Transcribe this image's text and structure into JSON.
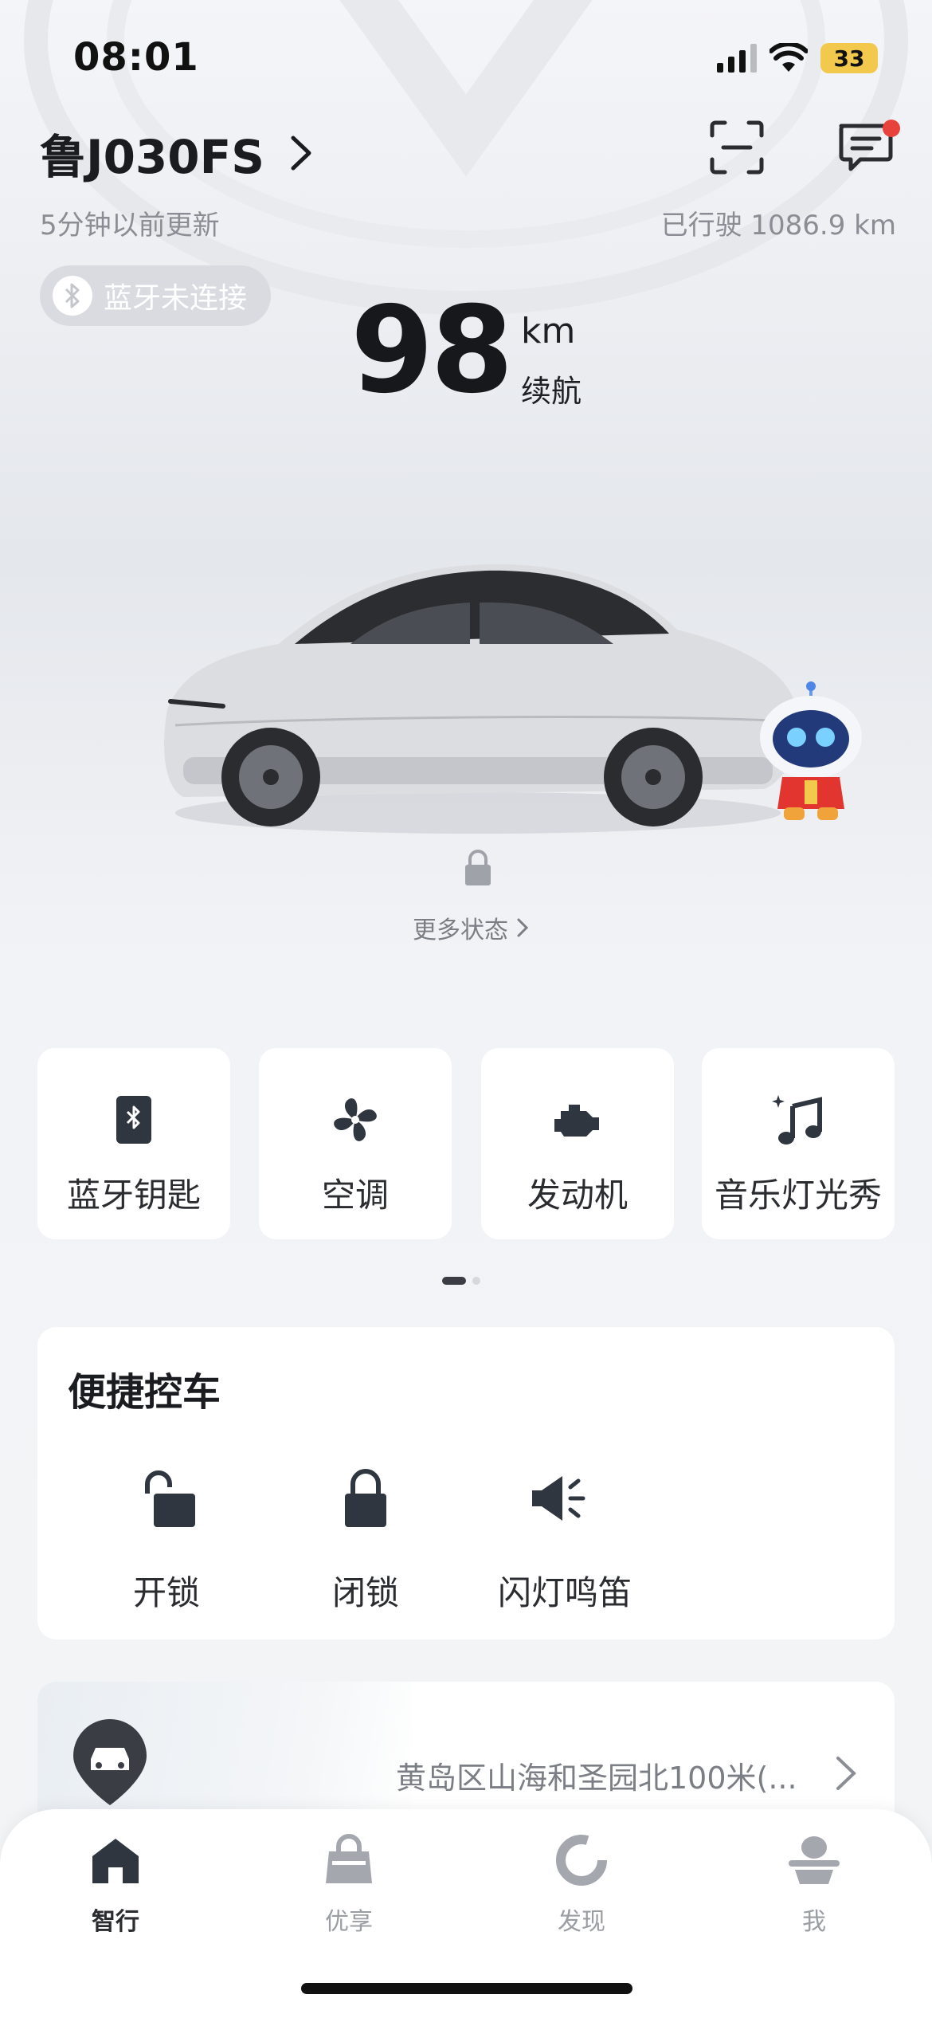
{
  "status_bar": {
    "time": "08:01",
    "battery": "33"
  },
  "header": {
    "plate": "鲁J030FS",
    "updated": "5分钟以前更新",
    "mileage": "已行驶 1086.9 km"
  },
  "bluetooth_status": "蓝牙未连接",
  "range": {
    "value": "98",
    "unit": "km",
    "label": "续航"
  },
  "more_status": "更多状态",
  "function_cards": [
    {
      "label": "蓝牙钥匙",
      "icon": "bluetooth-key-icon"
    },
    {
      "label": "空调",
      "icon": "fan-icon"
    },
    {
      "label": "发动机",
      "icon": "engine-icon"
    },
    {
      "label": "音乐灯光秀",
      "icon": "music-light-icon"
    }
  ],
  "quick_control": {
    "title": "便捷控车",
    "items": [
      {
        "label": "开锁",
        "icon": "unlock-icon"
      },
      {
        "label": "闭锁",
        "icon": "lock-icon"
      },
      {
        "label": "闪灯鸣笛",
        "icon": "horn-icon"
      }
    ]
  },
  "location": {
    "address": "黄岛区山海和圣园北100米(..."
  },
  "tabs": [
    {
      "label": "智行",
      "icon": "home-icon",
      "active": true
    },
    {
      "label": "优享",
      "icon": "bag-icon",
      "active": false
    },
    {
      "label": "发现",
      "icon": "discover-icon",
      "active": false
    },
    {
      "label": "我",
      "icon": "user-icon",
      "active": false
    }
  ],
  "colors": {
    "accent": "#2f3640",
    "notification": "#e8423c",
    "battery": "#f2c94c",
    "muted": "#8a8d93"
  }
}
